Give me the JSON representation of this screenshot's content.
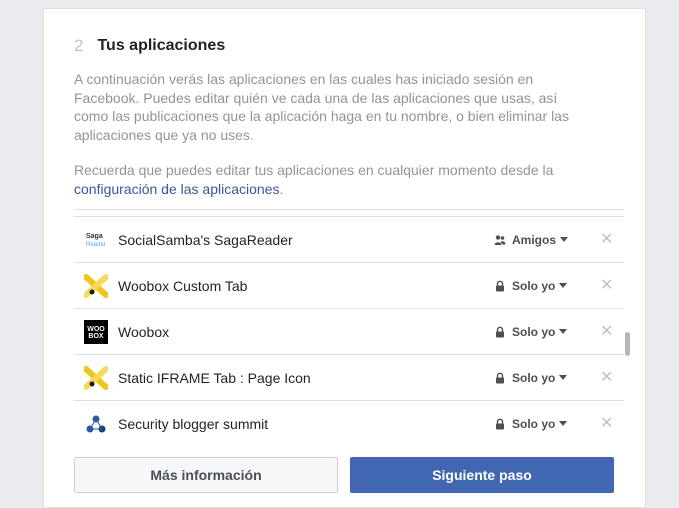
{
  "step": {
    "number": "2",
    "title": "Tus aplicaciones"
  },
  "description": "A continuación verás las aplicaciones en las cuales has iniciado sesión en Facebook. Puedes editar quién ve cada una de las aplicaciones que usas, así como las publicaciones que la aplicación haga en tu nombre, o bien eliminar las aplicaciones que ya no uses.",
  "reminder": {
    "text": "Recuerda que puedes editar tus aplicaciones en cualquier momento desde la",
    "link": "configuración de las aplicaciones",
    "suffix": "."
  },
  "apps": [
    {
      "name": "SocialSamba's SagaReader",
      "privacy": "Amigos",
      "privacy_icon": "friends-icon",
      "icon": "sagareader-icon",
      "icon_text_1": "Saga",
      "icon_text_2": "Reader"
    },
    {
      "name": "Woobox Custom Tab",
      "privacy": "Solo yo",
      "privacy_icon": "lock-icon",
      "icon": "woobox-custom-tab-icon"
    },
    {
      "name": "Woobox",
      "privacy": "Solo yo",
      "privacy_icon": "lock-icon",
      "icon": "woobox-logo-icon",
      "icon_text_1": "WOO",
      "icon_text_2": "BOX"
    },
    {
      "name": "Static IFRAME Tab : Page Icon",
      "privacy": "Solo yo",
      "privacy_icon": "lock-icon",
      "icon": "static-iframe-tab-icon"
    },
    {
      "name": "Security blogger summit",
      "privacy": "Solo yo",
      "privacy_icon": "lock-icon",
      "icon": "security-blogger-summit-icon"
    }
  ],
  "remove_glyph": "✕",
  "buttons": {
    "more_info": "Más información",
    "next_step": "Siguiente paso"
  },
  "colors": {
    "primary": "#4267b2",
    "link": "#365899",
    "muted_text": "#90949c"
  }
}
